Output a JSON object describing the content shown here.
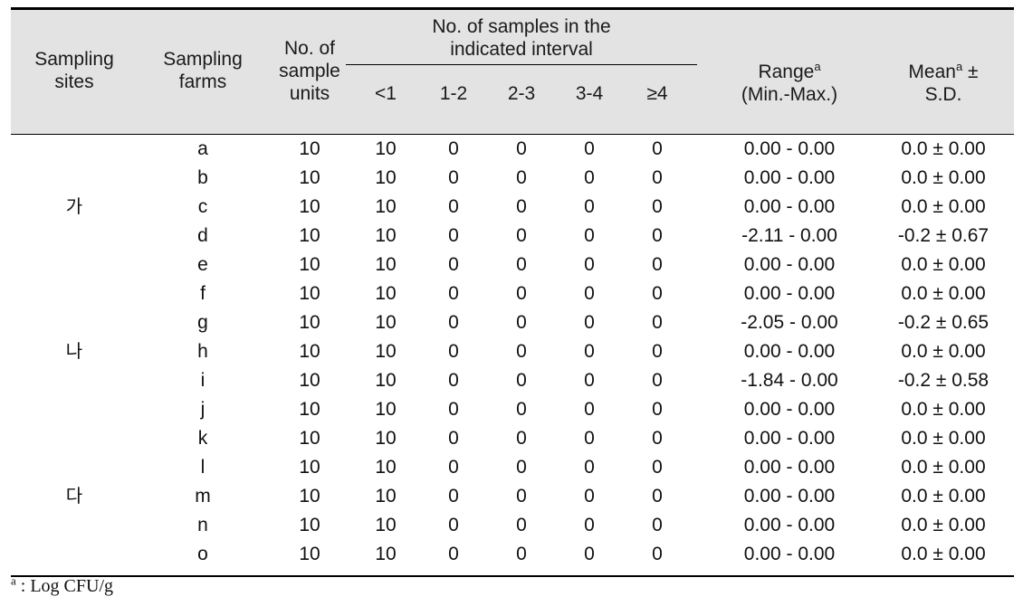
{
  "table": {
    "header": {
      "sampling_sites": "Sampling\nsites",
      "sampling_sites_l1": "Sampling",
      "sampling_sites_l2": "sites",
      "sampling_farms_l1": "Sampling",
      "sampling_farms_l2": "farms",
      "sample_units_l1": "No. of",
      "sample_units_l2": "sample",
      "sample_units_l3": "units",
      "group_l1": "No. of samples in the",
      "group_l2": "indicated interval",
      "intervals": [
        "<1",
        "1-2",
        "2-3",
        "3-4",
        "≥4"
      ],
      "range_l1": "Range",
      "range_sup": "a",
      "range_l2": "(Min.-Max.)",
      "mean_l1": "Mean",
      "mean_sup": "a",
      "mean_pm": "±",
      "mean_l2": "S.D."
    },
    "rows": [
      {
        "site": "",
        "farm": "a",
        "units": "10",
        "i1": "10",
        "i2": "0",
        "i3": "0",
        "i4": "0",
        "i5": "0",
        "range": "0.00  -  0.00",
        "mean": "0.0  ±  0.00"
      },
      {
        "site": "",
        "farm": "b",
        "units": "10",
        "i1": "10",
        "i2": "0",
        "i3": "0",
        "i4": "0",
        "i5": "0",
        "range": "0.00  -  0.00",
        "mean": "0.0  ±  0.00"
      },
      {
        "site": "가",
        "farm": "c",
        "units": "10",
        "i1": "10",
        "i2": "0",
        "i3": "0",
        "i4": "0",
        "i5": "0",
        "range": "0.00  -  0.00",
        "mean": "0.0  ±  0.00"
      },
      {
        "site": "",
        "farm": "d",
        "units": "10",
        "i1": "10",
        "i2": "0",
        "i3": "0",
        "i4": "0",
        "i5": "0",
        "range": "-2.11  -  0.00",
        "mean": "-0.2  ±  0.67"
      },
      {
        "site": "",
        "farm": "e",
        "units": "10",
        "i1": "10",
        "i2": "0",
        "i3": "0",
        "i4": "0",
        "i5": "0",
        "range": "0.00  -  0.00",
        "mean": "0.0  ±  0.00"
      },
      {
        "site": "",
        "farm": "f",
        "units": "10",
        "i1": "10",
        "i2": "0",
        "i3": "0",
        "i4": "0",
        "i5": "0",
        "range": "0.00  -  0.00",
        "mean": "0.0  ±  0.00"
      },
      {
        "site": "",
        "farm": "g",
        "units": "10",
        "i1": "10",
        "i2": "0",
        "i3": "0",
        "i4": "0",
        "i5": "0",
        "range": "-2.05  -  0.00",
        "mean": "-0.2  ±  0.65"
      },
      {
        "site": "나",
        "farm": "h",
        "units": "10",
        "i1": "10",
        "i2": "0",
        "i3": "0",
        "i4": "0",
        "i5": "0",
        "range": "0.00  -  0.00",
        "mean": "0.0  ±  0.00"
      },
      {
        "site": "",
        "farm": "i",
        "units": "10",
        "i1": "10",
        "i2": "0",
        "i3": "0",
        "i4": "0",
        "i5": "0",
        "range": "-1.84  -  0.00",
        "mean": "-0.2  ±  0.58"
      },
      {
        "site": "",
        "farm": "j",
        "units": "10",
        "i1": "10",
        "i2": "0",
        "i3": "0",
        "i4": "0",
        "i5": "0",
        "range": "0.00  -  0.00",
        "mean": "0.0  ±  0.00"
      },
      {
        "site": "",
        "farm": "k",
        "units": "10",
        "i1": "10",
        "i2": "0",
        "i3": "0",
        "i4": "0",
        "i5": "0",
        "range": "0.00  -  0.00",
        "mean": "0.0  ±  0.00"
      },
      {
        "site": "",
        "farm": "l",
        "units": "10",
        "i1": "10",
        "i2": "0",
        "i3": "0",
        "i4": "0",
        "i5": "0",
        "range": "0.00  -  0.00",
        "mean": "0.0  ±  0.00"
      },
      {
        "site": "다",
        "farm": "m",
        "units": "10",
        "i1": "10",
        "i2": "0",
        "i3": "0",
        "i4": "0",
        "i5": "0",
        "range": "0.00  -  0.00",
        "mean": "0.0  ±  0.00"
      },
      {
        "site": "",
        "farm": "n",
        "units": "10",
        "i1": "10",
        "i2": "0",
        "i3": "0",
        "i4": "0",
        "i5": "0",
        "range": "0.00  -  0.00",
        "mean": "0.0  ±  0.00"
      },
      {
        "site": "",
        "farm": "o",
        "units": "10",
        "i1": "10",
        "i2": "0",
        "i3": "0",
        "i4": "0",
        "i5": "0",
        "range": "0.00  -  0.00",
        "mean": "0.0  ±  0.00"
      }
    ],
    "footnote": {
      "sup": "a",
      "text": " :  Log  CFU/g"
    },
    "colors": {
      "header_background": "#e3e3e3",
      "rule": "#000000",
      "text": "#111111",
      "page_background": "#ffffff"
    }
  }
}
